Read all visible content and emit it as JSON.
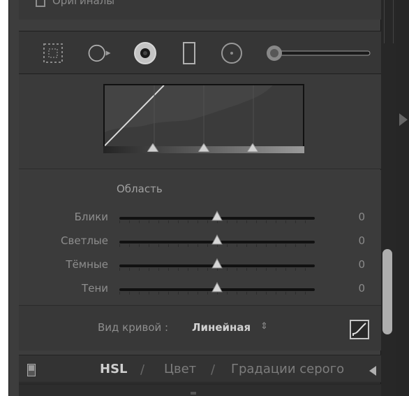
{
  "originals": {
    "label": "Оригиналы"
  },
  "toolbar": {
    "tools": [
      {
        "name": "rect-mask-icon"
      },
      {
        "name": "circle-tool-icon"
      },
      {
        "name": "radial-dot-icon"
      },
      {
        "name": "rect-tool-icon"
      },
      {
        "name": "circle-small-icon"
      }
    ]
  },
  "region": {
    "title": "Область",
    "sliders": [
      {
        "label": "Блики",
        "value": "0",
        "position": 0.5
      },
      {
        "label": "Светлые",
        "value": "0",
        "position": 0.5
      },
      {
        "label": "Тёмные",
        "value": "0",
        "position": 0.5
      },
      {
        "label": "Тени",
        "value": "0",
        "position": 0.5
      }
    ]
  },
  "curve": {
    "mode_label": "Вид кривой :",
    "mode_value": "Линейная",
    "mode_arrows": "⇕"
  },
  "tabs": {
    "hsl": "HSL",
    "sep": "/",
    "color": "Цвет",
    "gray": "Градации серого"
  }
}
